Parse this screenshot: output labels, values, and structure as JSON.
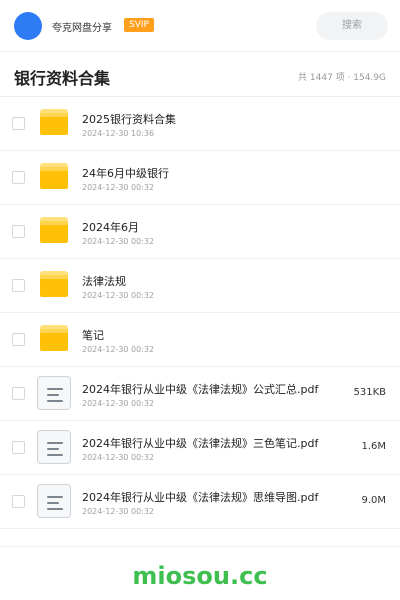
{
  "header": {
    "sharer_name": "夸克网盘分享",
    "badge": "SVIP",
    "search_label": "搜索"
  },
  "title_bar": {
    "title": "银行资料合集",
    "stats": "共 1447 项 · 154.9G"
  },
  "files": [
    {
      "type": "folder",
      "name": "2025银行资料合集",
      "date": "2024-12-30 10:36",
      "size": ""
    },
    {
      "type": "folder",
      "name": "24年6月中级银行",
      "date": "2024-12-30 00:32",
      "size": ""
    },
    {
      "type": "folder",
      "name": "2024年6月",
      "date": "2024-12-30 00:32",
      "size": ""
    },
    {
      "type": "folder",
      "name": "法律法规",
      "date": "2024-12-30 00:32",
      "size": ""
    },
    {
      "type": "folder",
      "name": "笔记",
      "date": "2024-12-30 00:32",
      "size": ""
    },
    {
      "type": "document",
      "name": "2024年银行从业中级《法律法规》公式汇总.pdf",
      "date": "2024-12-30 00:32",
      "size": "531KB"
    },
    {
      "type": "document",
      "name": "2024年银行从业中级《法律法规》三色笔记.pdf",
      "date": "2024-12-30 00:32",
      "size": "1.6M"
    },
    {
      "type": "document",
      "name": "2024年银行从业中级《法律法规》思维导图.pdf",
      "date": "2024-12-30 00:32",
      "size": "9.0M"
    }
  ],
  "watermark": "miosou.cc",
  "colors": {
    "avatar": "#2e7bf6",
    "svip_badge": "#ff9f1c",
    "folder": "#ffc107",
    "watermark": "#3fbf4f"
  }
}
